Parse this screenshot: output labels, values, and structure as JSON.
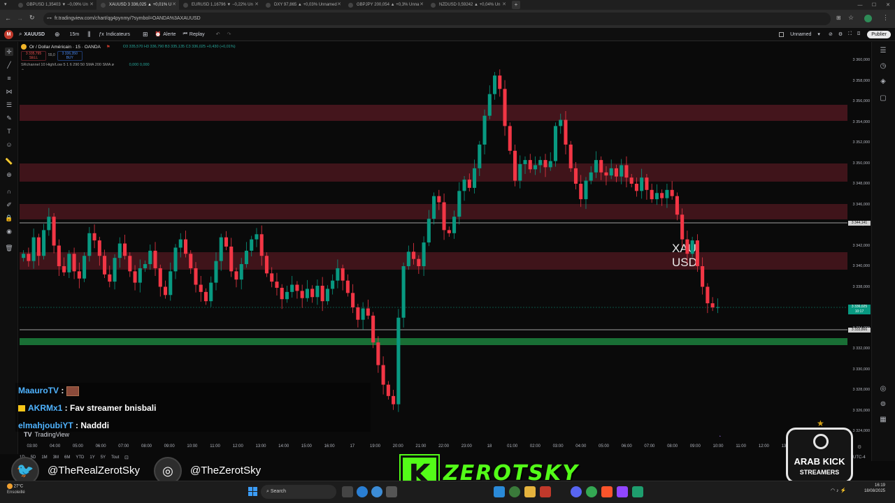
{
  "browser": {
    "tabs": [
      {
        "label": "GBPUSD 1,35403 ▼ −0,09% Un",
        "active": false
      },
      {
        "label": "XAUUSD 3 336,025 ▲ +0,01% U",
        "active": true
      },
      {
        "label": "EURUSD 1,16796 ▼ −0,22% Un",
        "active": false
      },
      {
        "label": "DXY 97,865 ▲ +0,03% Unnamed",
        "active": false
      },
      {
        "label": "GBPJPY 200,054 ▲ +0,3% Unna",
        "active": false
      },
      {
        "label": "NZDUSD 0,59242 ▲ +0,04% Un",
        "active": false
      }
    ],
    "url": "fr.tradingview.com/chart/qg4pynmy/?symbol=OANDA%3AXAUUSD"
  },
  "toolbar": {
    "symbol": "XAUUSD",
    "interval": "15m",
    "indicators": "Indicateurs",
    "alert": "Alerte",
    "replay": "Replay",
    "layout_name": "Unnamed",
    "publish": "Publier"
  },
  "legend": {
    "title": "Or / Dollar Américain · 15 · OANDA",
    "ohlc": "O3 335,570 H3 336,790 B3 335,135 C3 336,025 +0,430 (+0,01%)",
    "sell_price": "3 335,795",
    "sell_label": "SELL",
    "spread": "55,0",
    "buy_price": "3 336,350",
    "buy_label": "BUY",
    "indicator": "SRchannel 10 High/Low 5 1 6 290 50 SMA 200 SMA",
    "indicator_values": "0,000  0,000"
  },
  "watermark": {
    "line1": "XAU",
    "line2": "USD"
  },
  "price_scale": {
    "ticks": [
      "3 360,000",
      "3 358,000",
      "3 356,000",
      "3 354,000",
      "3 352,000",
      "3 350,000",
      "3 348,000",
      "3 346,000",
      "3 344,000",
      "3 342,000",
      "3 340,000",
      "3 338,000",
      "3 336,000",
      "3 334,000",
      "3 332,000",
      "3 330,000",
      "3 328,000",
      "3 326,000",
      "3 324,000"
    ],
    "hline_upper_label": "3 344,141",
    "current_price_label": "3 336,025",
    "countdown": "10:17",
    "hline_lower_label": "3 333,866"
  },
  "time_axis": {
    "ticks": [
      "03:00",
      "04:00",
      "05:00",
      "06:00",
      "07:00",
      "08:00",
      "09:00",
      "10:00",
      "11:00",
      "12:00",
      "13:00",
      "14:00",
      "15:00",
      "16:00",
      "17",
      "19:00",
      "20:00",
      "21:00",
      "22:00",
      "23:00",
      "18",
      "01:00",
      "02:00",
      "03:00",
      "04:00",
      "05:00",
      "06:00",
      "07:00",
      "08:00",
      "09:00",
      "10:00",
      "11:00",
      "12:00",
      "13:00"
    ],
    "timezone": "UTC-4"
  },
  "bottom_bar": {
    "ranges": [
      "1D",
      "5D",
      "1M",
      "3M",
      "6M",
      "YTD",
      "1Y",
      "5Y",
      "Tout"
    ],
    "tradingview_label": "TradingView"
  },
  "chat": [
    {
      "user": "MaauroTV",
      "text": ""
    },
    {
      "user": "AKRMx1",
      "text": "Fav streamer bnisbali"
    },
    {
      "user": "elmahjoubiYT",
      "text": "Nadddi"
    }
  ],
  "overlay": {
    "twitter_handle": "@TheRealZerotSky",
    "instagram_handle": "@TheZerotSky",
    "brand": "ZEROTSKY",
    "brand_letter": "K",
    "badge_line1": "ARAB KICK",
    "badge_line2": "STREAMERS"
  },
  "taskbar": {
    "weather_temp": "27°C",
    "weather_text": "Ensoleillé",
    "search_label": "Search",
    "time": "16:19",
    "date": "18/08/2025"
  },
  "chart_data": {
    "type": "candlestick",
    "symbol": "XAUUSD",
    "interval": "15m",
    "ylim": [
      3323,
      3361
    ],
    "close_series": [
      3341.2,
      3340.5,
      3342.8,
      3341.0,
      3343.5,
      3344.8,
      3342.0,
      3340.0,
      3339.4,
      3341.2,
      3339.5,
      3338.8,
      3341.0,
      3343.2,
      3342.5,
      3341.0,
      3339.2,
      3338.5,
      3340.8,
      3342.2,
      3341.0,
      3339.5,
      3338.4,
      3339.8,
      3340.2,
      3341.5,
      3339.8,
      3338.0,
      3337.2,
      3339.5,
      3341.8,
      3342.6,
      3341.2,
      3339.8,
      3338.2,
      3337.5,
      3336.6,
      3338.4,
      3340.5,
      3342.8,
      3341.9,
      3339.5,
      3338.7,
      3340.2,
      3341.5,
      3342.6,
      3343.1,
      3341.0,
      3339.3,
      3338.5,
      3337.9,
      3336.8,
      3337.5,
      3338.2,
      3337.6,
      3336.9,
      3337.8,
      3337.0,
      3338.1,
      3336.6,
      3337.8,
      3338.6,
      3339.8,
      3338.6,
      3337.4,
      3336.0,
      3334.8,
      3335.9,
      3335.2,
      3332.6,
      3330.4,
      3328.5,
      3327.4,
      3326.6,
      3335.0,
      3340.0,
      3341.4,
      3340.7,
      3340.0,
      3342.3,
      3344.6,
      3346.8,
      3346.2,
      3343.5,
      3343.2,
      3344.8,
      3347.3,
      3348.4,
      3347.6,
      3349.5,
      3351.8,
      3354.6,
      3356.7,
      3358.5,
      3357.2,
      3353.6,
      3351.2,
      3348.3,
      3349.9,
      3350.3,
      3349.4,
      3349.8,
      3350.3,
      3349.6,
      3350.2,
      3353.6,
      3354.2,
      3351.8,
      3349.5,
      3348.0,
      3346.5,
      3348.3,
      3349.1,
      3350.3,
      3349.1,
      3348.8,
      3349.5,
      3348.7,
      3349.8,
      3348.6,
      3348.0,
      3347.3,
      3348.6,
      3347.4,
      3346.5,
      3347.1,
      3346.6,
      3347.4,
      3346.8,
      3345.0,
      3342.6,
      3341.2,
      3342.5,
      3340.0,
      3338.0,
      3336.4,
      3336.0,
      3336.025
    ]
  }
}
